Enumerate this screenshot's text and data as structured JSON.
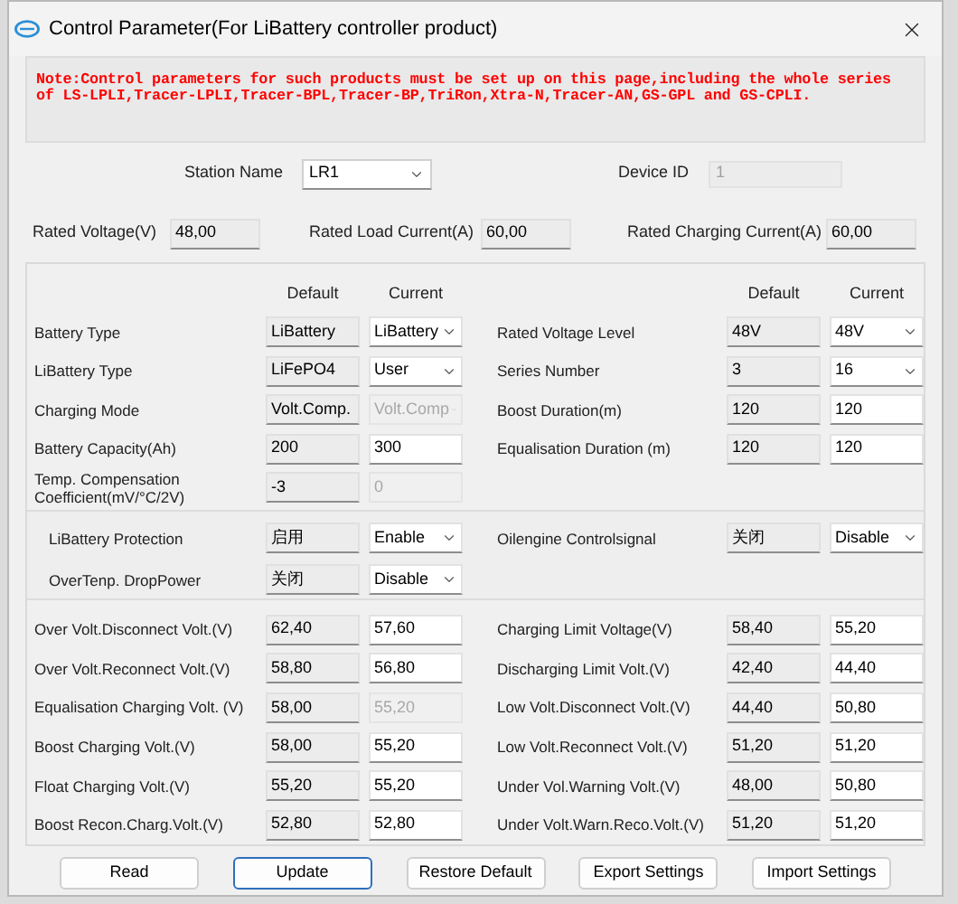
{
  "window": {
    "title": "Control Parameter(For LiBattery controller product)"
  },
  "note": "Note:Control parameters for such products must be set up on this page,including the whole series of LS-LPLI,Tracer-LPLI,Tracer-BPL,Tracer-BP,TriRon,Xtra-N,Tracer-AN,GS-GPL and GS-CPLI.",
  "station": {
    "label": "Station Name",
    "value": "LR1"
  },
  "device_id": {
    "label": "Device ID",
    "value": "1",
    "disabled": true
  },
  "rated": [
    {
      "label": "Rated Voltage(V)",
      "value": "48,00"
    },
    {
      "label": "Rated Load Current(A)",
      "value": "60,00"
    },
    {
      "label": "Rated Charging Current(A)",
      "value": "60,00"
    }
  ],
  "column_headers": {
    "left": [
      "Default",
      "Current"
    ],
    "right": [
      "Default",
      "Current"
    ]
  },
  "settings_left": [
    {
      "label": "Battery Type",
      "default": "LiBattery",
      "current": {
        "value": "LiBattery",
        "kind": "select",
        "disabled": false
      }
    },
    {
      "label": "LiBattery Type",
      "default": "LiFePO4",
      "current": {
        "value": "User",
        "kind": "select",
        "disabled": false
      }
    },
    {
      "label": "Charging Mode",
      "default": "Volt.Comp.",
      "current": {
        "value": "Volt.Comp",
        "kind": "select",
        "disabled": true
      }
    },
    {
      "label": "Battery Capacity(Ah)",
      "default": "200",
      "current": {
        "value": "300",
        "kind": "input",
        "disabled": false
      }
    },
    {
      "label": "Temp. Compensation Coefficient(mV/°C/2V)",
      "default": "-3",
      "current": {
        "value": "0",
        "kind": "input",
        "disabled": true
      }
    }
  ],
  "settings_right": [
    {
      "label": "Rated Voltage Level",
      "default": "48V",
      "current": {
        "value": "48V",
        "kind": "select",
        "disabled": false
      }
    },
    {
      "label": "Series Number",
      "default": "3",
      "current": {
        "value": "16",
        "kind": "select",
        "disabled": false
      }
    },
    {
      "label": "Boost Duration(m)",
      "default": "120",
      "current": {
        "value": "120",
        "kind": "input",
        "disabled": false
      }
    },
    {
      "label": "Equalisation Duration (m)",
      "default": "120",
      "current": {
        "value": "120",
        "kind": "input",
        "disabled": false
      }
    }
  ],
  "protection_left": [
    {
      "label": "LiBattery Protection",
      "default": "启用",
      "current": {
        "value": "Enable",
        "kind": "select",
        "disabled": false
      }
    },
    {
      "label": "OverTenp. DropPower",
      "default": "关闭",
      "current": {
        "value": "Disable",
        "kind": "select",
        "disabled": false
      }
    }
  ],
  "protection_right": [
    {
      "label": "Oilengine Controlsignal",
      "default": "关闭",
      "current": {
        "value": "Disable",
        "kind": "select",
        "disabled": false
      }
    }
  ],
  "voltages_left": [
    {
      "label": "Over Volt.Disconnect Volt.(V)",
      "default": "62,40",
      "current": {
        "value": "57,60",
        "kind": "input",
        "disabled": false
      }
    },
    {
      "label": "Over Volt.Reconnect Volt.(V)",
      "default": "58,80",
      "current": {
        "value": "56,80",
        "kind": "input",
        "disabled": false
      }
    },
    {
      "label": "Equalisation Charging Volt. (V)",
      "default": "58,00",
      "current": {
        "value": "55,20",
        "kind": "input",
        "disabled": true
      }
    },
    {
      "label": "Boost Charging Volt.(V)",
      "default": "58,00",
      "current": {
        "value": "55,20",
        "kind": "input",
        "disabled": false
      }
    },
    {
      "label": "Float Charging Volt.(V)",
      "default": "55,20",
      "current": {
        "value": "55,20",
        "kind": "input",
        "disabled": false
      }
    },
    {
      "label": "Boost Recon.Charg.Volt.(V)",
      "default": "52,80",
      "current": {
        "value": "52,80",
        "kind": "input",
        "disabled": false
      }
    }
  ],
  "voltages_right": [
    {
      "label": "Charging Limit Voltage(V)",
      "default": "58,40",
      "current": {
        "value": "55,20",
        "kind": "input",
        "disabled": false
      }
    },
    {
      "label": "Discharging Limit Volt.(V)",
      "default": "42,40",
      "current": {
        "value": "44,40",
        "kind": "input",
        "disabled": false
      }
    },
    {
      "label": "Low Volt.Disconnect Volt.(V)",
      "default": "44,40",
      "current": {
        "value": "50,80",
        "kind": "input",
        "disabled": false
      }
    },
    {
      "label": "Low Volt.Reconnect Volt.(V)",
      "default": "51,20",
      "current": {
        "value": "51,20",
        "kind": "input",
        "disabled": false
      }
    },
    {
      "label": "Under Vol.Warning Volt.(V)",
      "default": "48,00",
      "current": {
        "value": "50,80",
        "kind": "input",
        "disabled": false
      }
    },
    {
      "label": "Under Volt.Warn.Reco.Volt.(V)",
      "default": "51,20",
      "current": {
        "value": "51,20",
        "kind": "input",
        "disabled": false
      }
    }
  ],
  "buttons": [
    {
      "label": "Read",
      "selected": false
    },
    {
      "label": "Update",
      "selected": true
    },
    {
      "label": "Restore Default",
      "selected": false
    },
    {
      "label": "Export Settings",
      "selected": false
    },
    {
      "label": "Import Settings",
      "selected": false
    }
  ]
}
